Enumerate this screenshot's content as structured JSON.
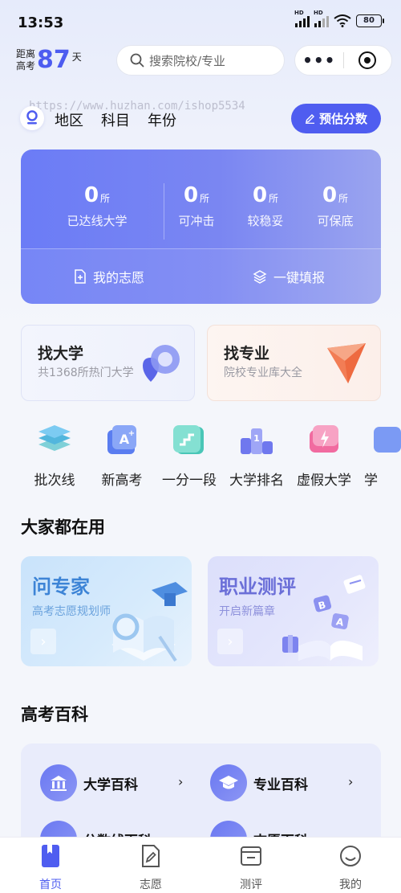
{
  "status_bar": {
    "time": "13:53",
    "battery": "80"
  },
  "header": {
    "countdown_label_1": "距离",
    "countdown_label_2": "高考",
    "countdown_days": "87",
    "countdown_unit": "天",
    "search_placeholder": "搜索院校/专业",
    "capsule_more": "•••"
  },
  "watermark": "https://www.huzhan.com/ishop5534",
  "filters": {
    "region": "地区",
    "subject": "科目",
    "year": "年份"
  },
  "estimate_button": "预估分数",
  "stats": {
    "items": [
      {
        "num": "0",
        "unit": "所",
        "label": "已达线大学"
      },
      {
        "num": "0",
        "unit": "所",
        "label": "可冲击"
      },
      {
        "num": "0",
        "unit": "所",
        "label": "较稳妥"
      },
      {
        "num": "0",
        "unit": "所",
        "label": "可保底"
      }
    ],
    "my_wishes": "我的志愿",
    "one_click_fill": "一键填报"
  },
  "find": {
    "university": {
      "title": "找大学",
      "subtitle": "共1368所热门大学"
    },
    "major": {
      "title": "找专业",
      "subtitle": "院校专业库大全"
    }
  },
  "tools": [
    {
      "label": "批次线",
      "icon": "layers-icon"
    },
    {
      "label": "新高考",
      "icon": "a-plus-icon"
    },
    {
      "label": "一分一段",
      "icon": "steps-icon"
    },
    {
      "label": "大学排名",
      "icon": "ranking-icon"
    },
    {
      "label": "虚假大学",
      "icon": "warning-icon"
    },
    {
      "label": "学",
      "icon": "more-tool-icon"
    }
  ],
  "section_popular": "大家都在用",
  "promos": {
    "expert": {
      "title": "问专家",
      "subtitle": "高考志愿规划师"
    },
    "career": {
      "title": "职业测评",
      "subtitle": "开启新篇章"
    }
  },
  "section_encyclopedia": "高考百科",
  "encyclopedia": {
    "items": [
      {
        "label": "大学百科"
      },
      {
        "label": "专业百科"
      },
      {
        "label": "分数线百科"
      },
      {
        "label": "志愿百科"
      }
    ]
  },
  "tabbar": {
    "items": [
      {
        "label": "首页"
      },
      {
        "label": "志愿"
      },
      {
        "label": "测评"
      },
      {
        "label": "我的"
      }
    ]
  },
  "colors": {
    "accent": "#4f5df0",
    "stats_card": "#6b7cf6",
    "page_bg": "#f4f6fb"
  }
}
